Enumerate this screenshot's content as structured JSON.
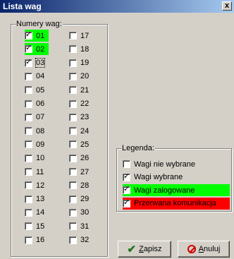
{
  "window": {
    "title": "Lista wag",
    "close_glyph": "x"
  },
  "numbers_group": {
    "label": "Numery wag:",
    "left_column": [
      {
        "label": "01",
        "checked": true,
        "state": "zalogowane"
      },
      {
        "label": "02",
        "checked": true,
        "state": "zalogowane"
      },
      {
        "label": "03",
        "checked": true,
        "state": "wybrane"
      },
      {
        "label": "04",
        "checked": false,
        "state": "none"
      },
      {
        "label": "05",
        "checked": false,
        "state": "none"
      },
      {
        "label": "06",
        "checked": false,
        "state": "none"
      },
      {
        "label": "07",
        "checked": false,
        "state": "none"
      },
      {
        "label": "08",
        "checked": false,
        "state": "none"
      },
      {
        "label": "09",
        "checked": false,
        "state": "none"
      },
      {
        "label": "10",
        "checked": false,
        "state": "none"
      },
      {
        "label": "11",
        "checked": false,
        "state": "none"
      },
      {
        "label": "12",
        "checked": false,
        "state": "none"
      },
      {
        "label": "13",
        "checked": false,
        "state": "none"
      },
      {
        "label": "14",
        "checked": false,
        "state": "none"
      },
      {
        "label": "15",
        "checked": false,
        "state": "none"
      },
      {
        "label": "16",
        "checked": false,
        "state": "none"
      }
    ],
    "right_column": [
      {
        "label": "17",
        "checked": false
      },
      {
        "label": "18",
        "checked": false
      },
      {
        "label": "19",
        "checked": false
      },
      {
        "label": "20",
        "checked": false
      },
      {
        "label": "21",
        "checked": false
      },
      {
        "label": "22",
        "checked": false
      },
      {
        "label": "23",
        "checked": false
      },
      {
        "label": "24",
        "checked": false
      },
      {
        "label": "25",
        "checked": false
      },
      {
        "label": "26",
        "checked": false
      },
      {
        "label": "27",
        "checked": false
      },
      {
        "label": "28",
        "checked": false
      },
      {
        "label": "29",
        "checked": false
      },
      {
        "label": "30",
        "checked": false
      },
      {
        "label": "31",
        "checked": false
      },
      {
        "label": "32",
        "checked": false
      }
    ]
  },
  "legend_group": {
    "label": "Legenda:",
    "items": [
      {
        "label": "Wagi nie wybrane",
        "checked": false,
        "color": ""
      },
      {
        "label": "Wagi wybrane",
        "checked": true,
        "color": ""
      },
      {
        "label": "Wagi zalogowane",
        "checked": true,
        "color": "#00ff00"
      },
      {
        "label": "Przerwana komunikacja",
        "checked": true,
        "color": "#ff0000"
      }
    ]
  },
  "buttons": {
    "save": {
      "prefix": "",
      "underline": "Z",
      "rest": "apisz"
    },
    "cancel": {
      "prefix": "",
      "underline": "A",
      "rest": "nuluj"
    }
  },
  "colors": {
    "logged": "#00ff00",
    "broken": "#ff0000"
  },
  "icons": {
    "check": "check-icon",
    "cancel": "no-entry-icon",
    "close": "close-icon"
  }
}
